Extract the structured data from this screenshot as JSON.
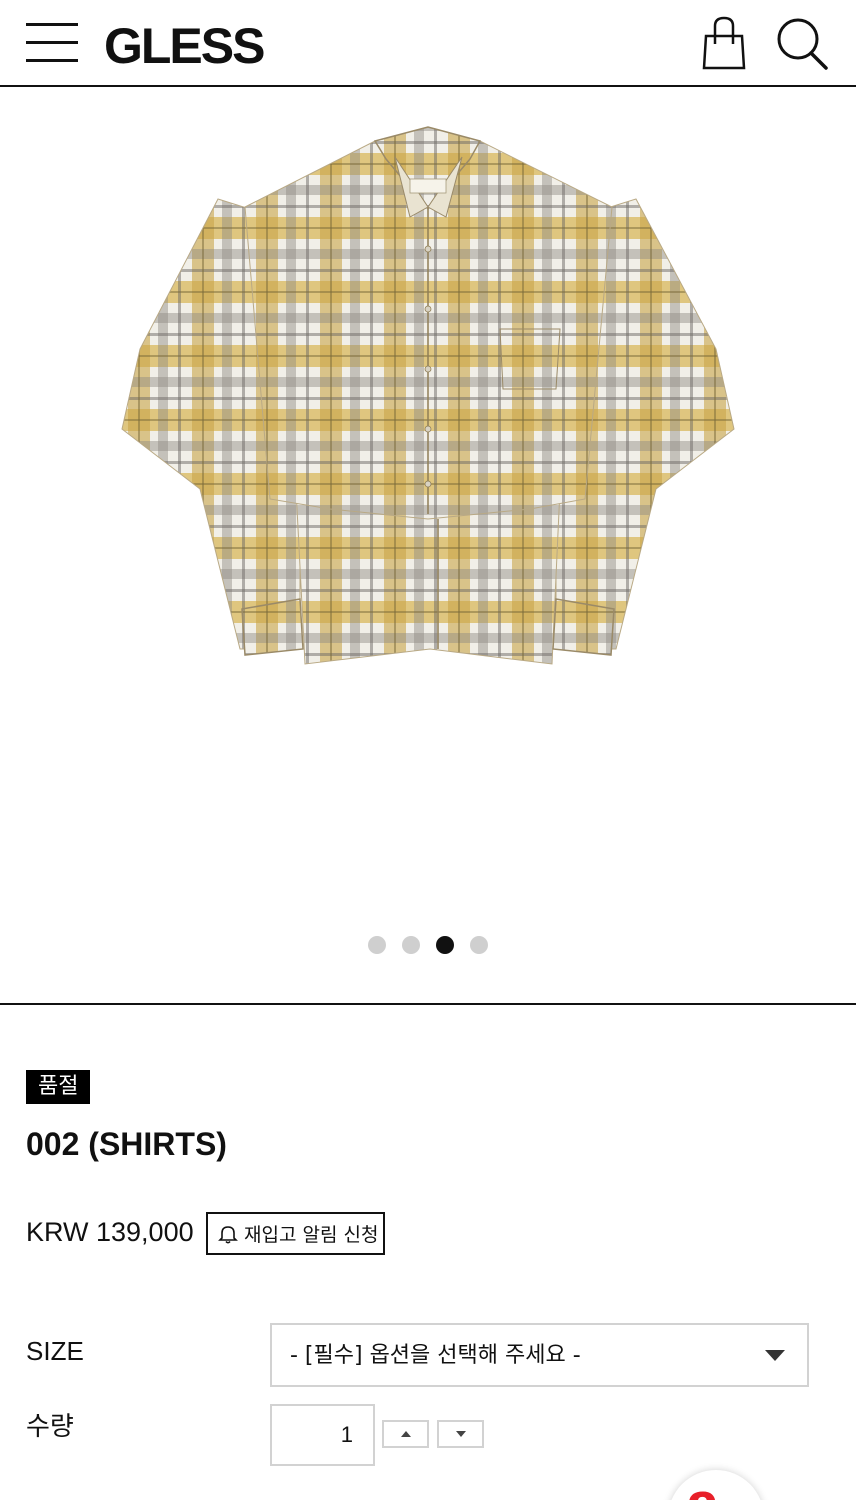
{
  "header": {
    "logo": "GLESS",
    "menu_icon": "hamburger-menu-icon",
    "cart_icon": "shopping-bag-icon",
    "search_icon": "search-icon"
  },
  "gallery": {
    "image_alt": "plaid layered shirt",
    "slide_count": 4,
    "active_slide": 3
  },
  "product": {
    "badge": "품절",
    "name": "002 (SHIRTS)",
    "price": "KRW 139,000",
    "restock_label": "재입고 알림 신청",
    "restock_icon": "bell-icon"
  },
  "options": {
    "size_label": "SIZE",
    "size_select_value": "- [필수] 옵션을 선택해 주세요 -",
    "qty_label": "수량",
    "qty_value": "1"
  },
  "floating": {
    "mark": "a"
  },
  "colors": {
    "accent": "#111111",
    "badge_bg": "#000000",
    "floating_red": "#e8202a",
    "dot_inactive": "#cfcfcf"
  }
}
